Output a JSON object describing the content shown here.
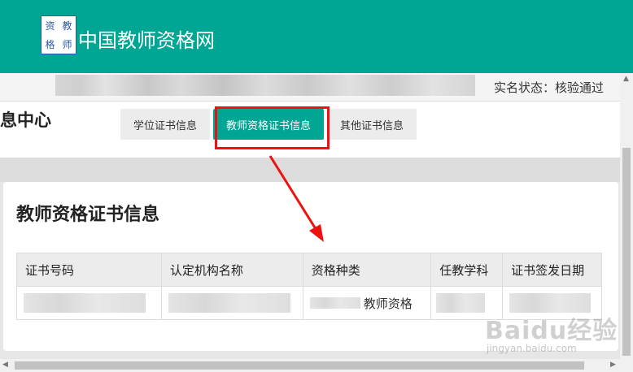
{
  "header": {
    "logo_chars": [
      "资",
      "教",
      "格",
      "师"
    ],
    "site_title": "中国教师资格网",
    "brand_color": "#00a694"
  },
  "userbar": {
    "verify_status": "实名状态：核验通过"
  },
  "center": {
    "title": "息中心",
    "tabs": [
      {
        "label": "学位证书信息",
        "active": false
      },
      {
        "label": "教师资格证书信息",
        "active": true
      },
      {
        "label": "其他证书信息",
        "active": false
      }
    ]
  },
  "section": {
    "title": "教师资格证书信息",
    "table": {
      "columns": [
        "证书号码",
        "认定机构名称",
        "资格种类",
        "任教学科",
        "证书签发日期"
      ],
      "rows": [
        {
          "cert_no": "",
          "authority": "",
          "type_suffix": "教师资格",
          "subject": "",
          "issue_date": ""
        }
      ]
    }
  },
  "watermark": {
    "brand": "Baidu经验",
    "url": "jingyan.baidu.com"
  },
  "annotation_color": "#e11"
}
